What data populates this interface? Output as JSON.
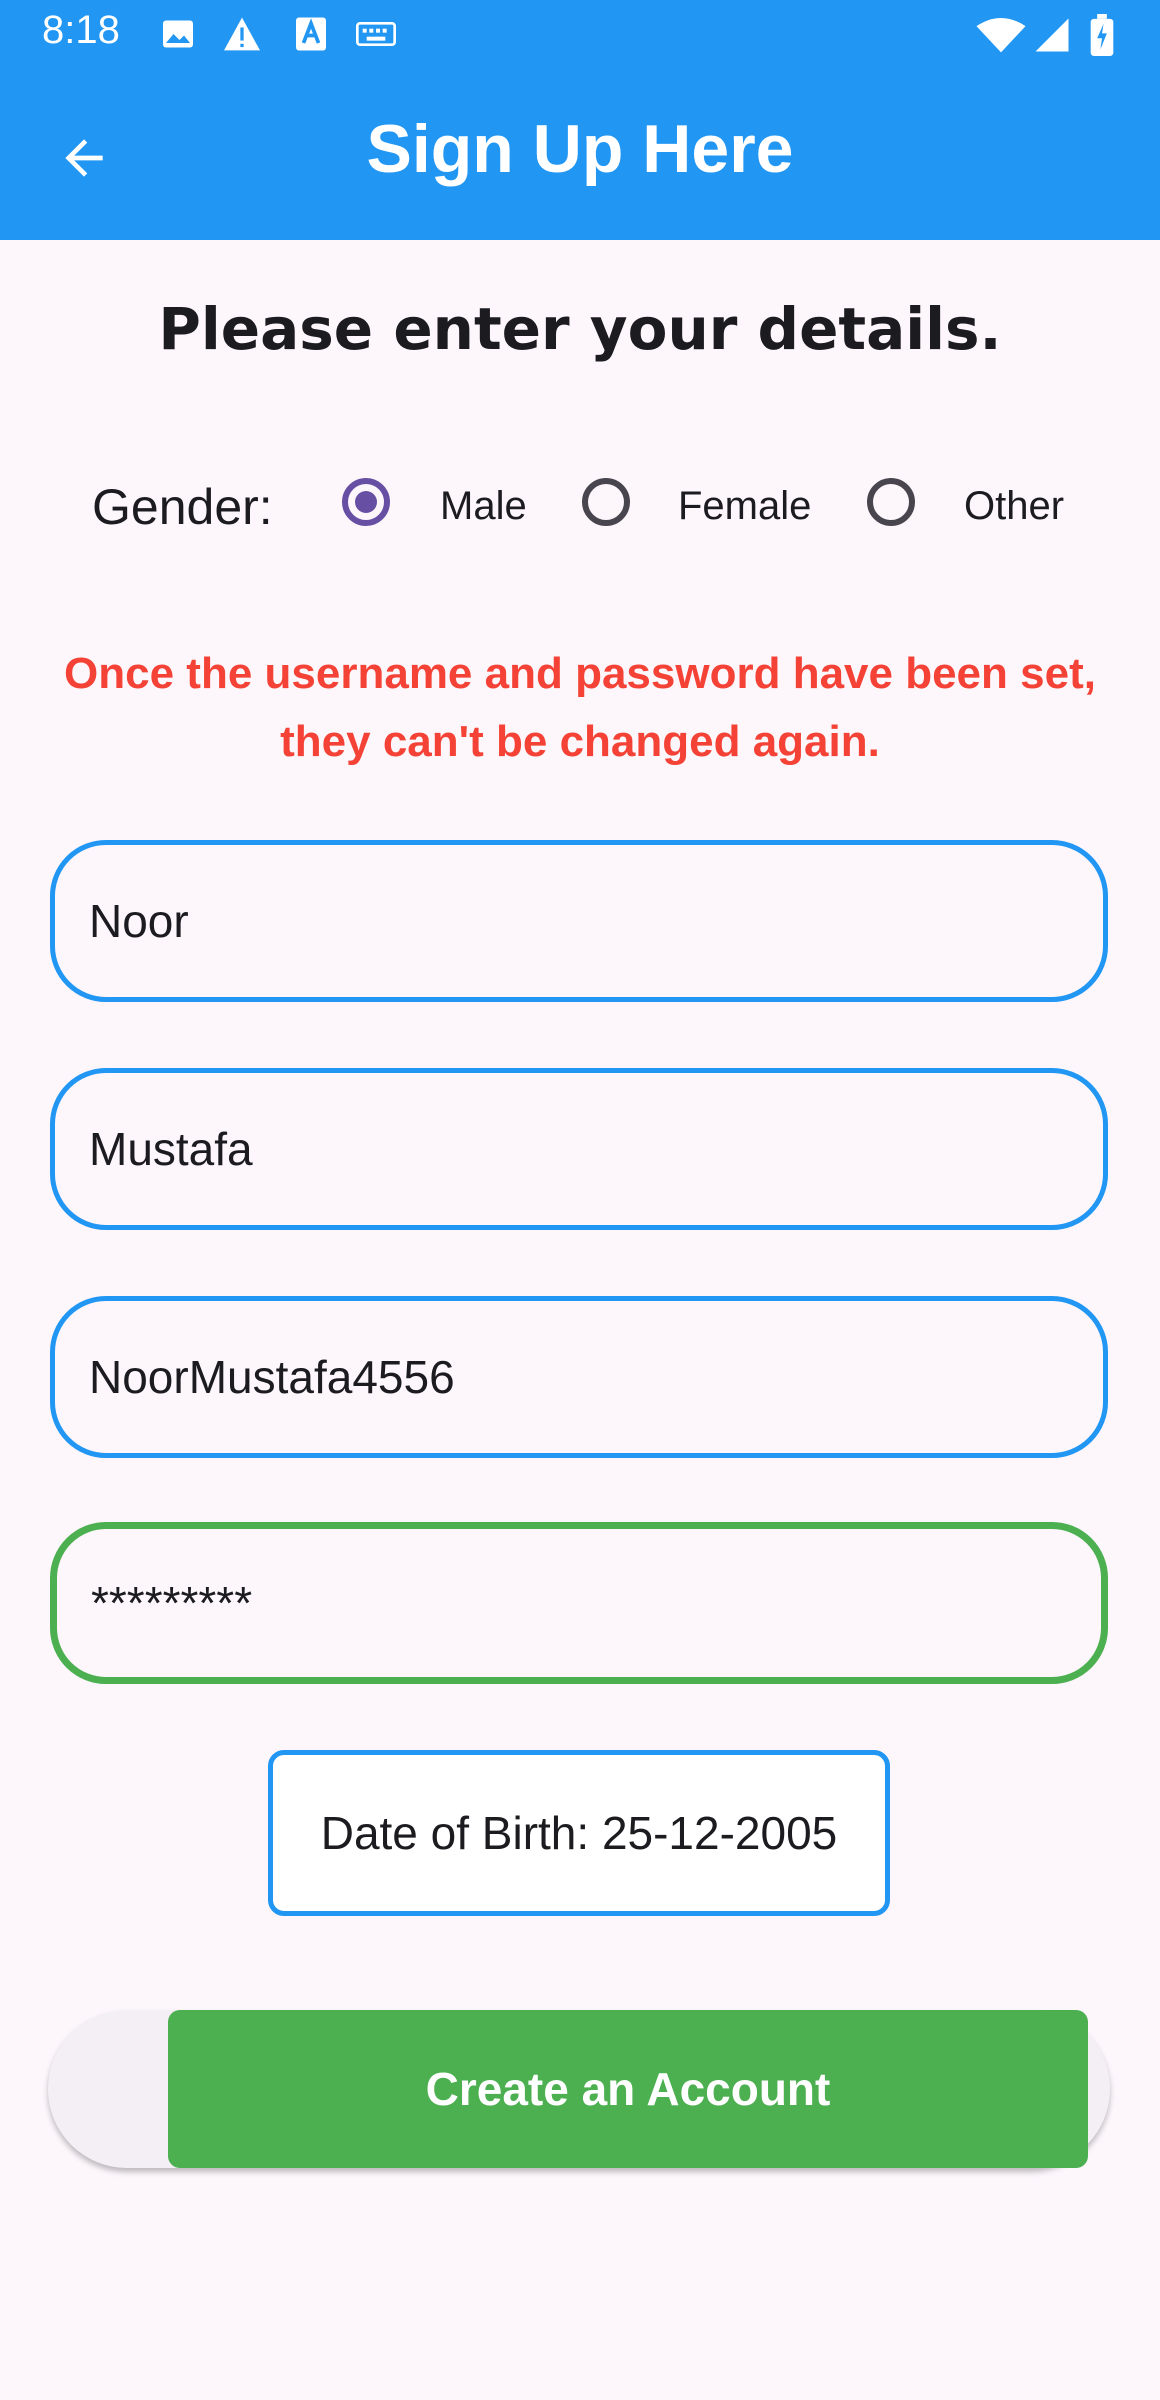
{
  "status_bar": {
    "time": "8:18"
  },
  "app_bar": {
    "title": "Sign Up Here"
  },
  "form": {
    "heading": "Please enter your details.",
    "gender": {
      "label": "Gender:",
      "options": [
        "Male",
        "Female",
        "Other"
      ],
      "selected": "Male"
    },
    "warning": "Once the username and password have been set, they can't be changed again.",
    "fields": {
      "first_name": "Noor",
      "last_name": "Mustafa",
      "username": "NoorMustafa4556",
      "password": "*********"
    },
    "dob": "Date of Birth: 25-12-2005",
    "submit_label": "Create an Account"
  },
  "colors": {
    "primary": "#2196f3",
    "success": "#4caf50",
    "warning": "#f44336",
    "radio_selected": "#6750a4"
  }
}
